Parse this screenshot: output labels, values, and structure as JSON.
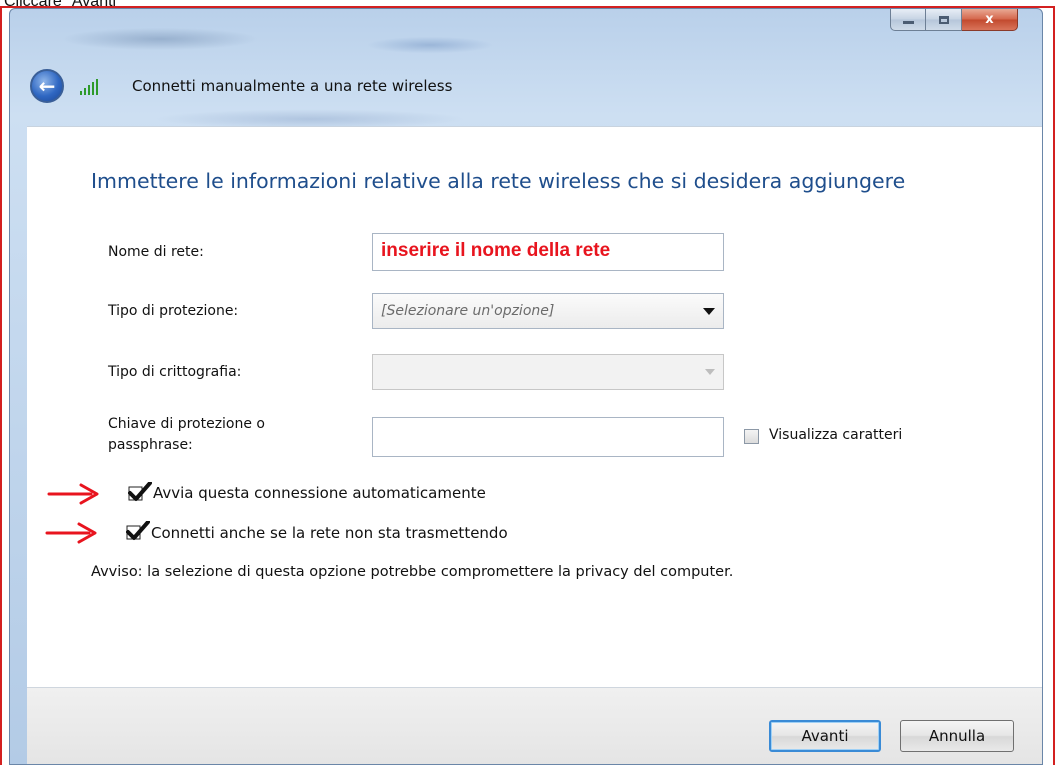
{
  "page": {
    "caption": "Cliccare \"Avanti\""
  },
  "window": {
    "title": "Connetti manualmente a una rete wireless",
    "controls": {
      "minimize": "minimize",
      "maximize": "maximize",
      "close": "x"
    }
  },
  "content": {
    "heading": "Immettere le informazioni relative alla rete wireless che si desidera aggiungere",
    "network_name": {
      "label": "Nome di rete:",
      "hint": "inserire il nome della rete"
    },
    "security_type": {
      "label": "Tipo di protezione:",
      "selected": "[Selezionare un'opzione]"
    },
    "encryption_type": {
      "label": "Tipo di crittografia:",
      "selected": ""
    },
    "security_key": {
      "label_line1": "Chiave di protezione o",
      "label_line2": "passphrase:",
      "value": "",
      "show_chars_label": "Visualizza caratteri",
      "show_chars_checked": false
    },
    "auto_start": {
      "label": "Avvia questa connessione automaticamente",
      "checked": true
    },
    "connect_hidden": {
      "label": "Connetti anche se la rete non sta trasmettendo",
      "checked": true
    },
    "warning": "Avviso: la selezione di questa opzione potrebbe compromettere la privacy del computer."
  },
  "footer": {
    "next_label": "Avanti",
    "cancel_label": "Annulla"
  },
  "colors": {
    "annotation_red": "#e8141e",
    "heading_blue": "#1f4e8c",
    "frame_red": "#d32020"
  }
}
